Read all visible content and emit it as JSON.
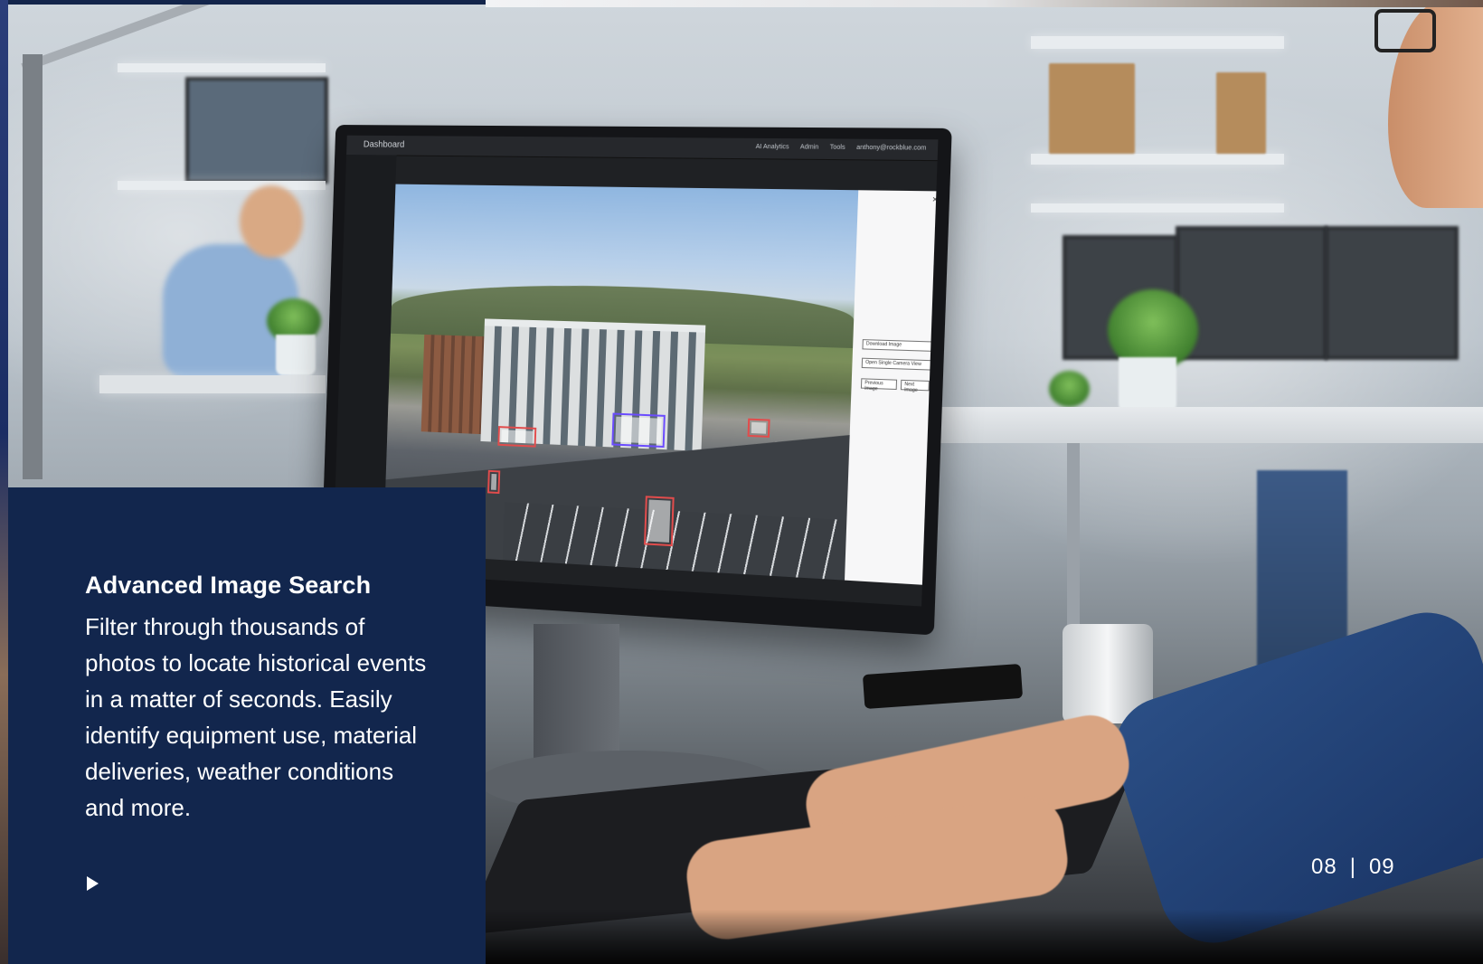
{
  "card": {
    "title": "Advanced Image Search",
    "body": "Filter through thousands of photos to locate historical events in a matter of seconds. Easily identify equipment use, material deliveries, weather conditions and more."
  },
  "pager": {
    "current": "08",
    "separator": "|",
    "total": "09"
  },
  "dashboard": {
    "title": "Dashboard",
    "menu": [
      "AI Analytics",
      "Admin",
      "Tools",
      "anthony@rockblue.com"
    ],
    "panel_buttons": [
      "Download Image",
      "Open Single Camera View",
      "Previous Image",
      "Next Image"
    ]
  },
  "icons": {
    "play": "play-icon",
    "close": "close-icon"
  },
  "colors": {
    "card_bg": "#12264d",
    "top_strip": "#13254b",
    "detection_red": "#e24c4c",
    "detection_blue": "#6b4cff"
  }
}
